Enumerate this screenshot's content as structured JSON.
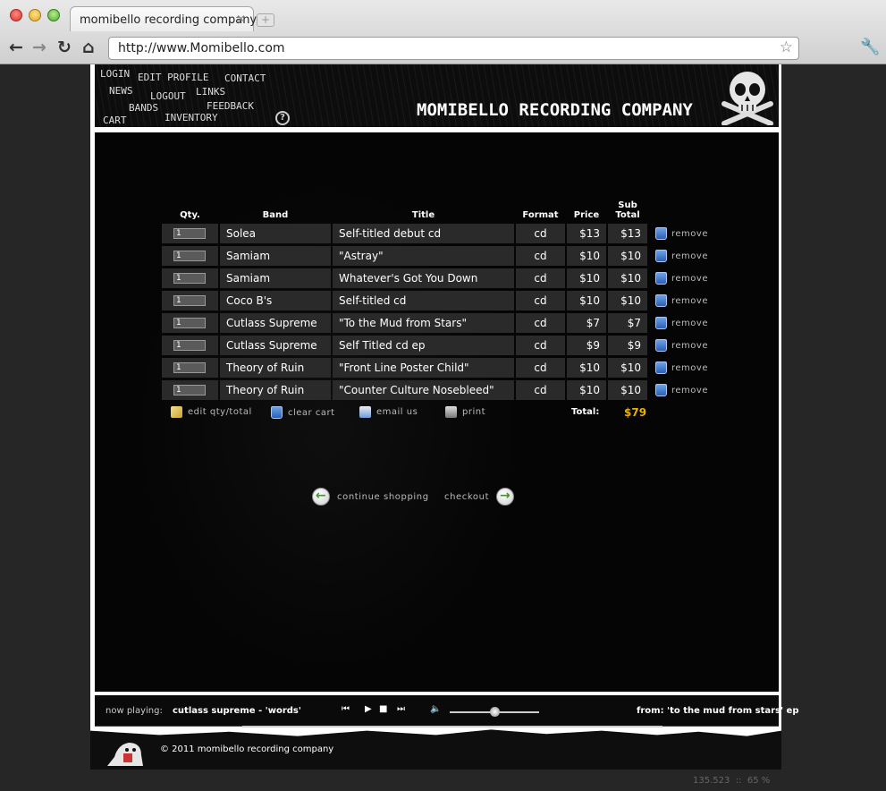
{
  "browser": {
    "tab_title": "momibello recording company",
    "url": "http://www.Momibello.com",
    "tab_close": "×",
    "new_tab": "+"
  },
  "nav": {
    "login": "LOGIN",
    "edit_profile": "EDIT PROFILE",
    "contact": "CONTACT",
    "news": "NEWS",
    "logout": "LOGOUT",
    "links": "LINKS",
    "bands": "BANDS",
    "feedback": "FEEDBACK",
    "cart": "CART",
    "inventory": "INVENTORY",
    "help": "?"
  },
  "brand": "MOMIBELLO RECORDING COMPANY",
  "cart": {
    "headers": {
      "qty": "Qty.",
      "band": "Band",
      "title": "Title",
      "format": "Format",
      "price": "Price",
      "subtotal_1": "Sub",
      "subtotal_2": "Total"
    },
    "remove_label": "remove",
    "rows": [
      {
        "qty": "1",
        "band": "Solea",
        "title": "Self-titled debut cd",
        "format": "cd",
        "price": "$13",
        "subtotal": "$13"
      },
      {
        "qty": "1",
        "band": "Samiam",
        "title": "\"Astray\"",
        "format": "cd",
        "price": "$10",
        "subtotal": "$10"
      },
      {
        "qty": "1",
        "band": "Samiam",
        "title": "Whatever's Got You Down",
        "format": "cd",
        "price": "$10",
        "subtotal": "$10"
      },
      {
        "qty": "1",
        "band": "Coco B's",
        "title": "Self-titled cd",
        "format": "cd",
        "price": "$10",
        "subtotal": "$10"
      },
      {
        "qty": "1",
        "band": "Cutlass Supreme",
        "title": "\"To the Mud from Stars\"",
        "format": "cd",
        "price": "$7",
        "subtotal": "$7"
      },
      {
        "qty": "1",
        "band": "Cutlass Supreme",
        "title": "Self Titled cd ep",
        "format": "cd",
        "price": "$9",
        "subtotal": "$9"
      },
      {
        "qty": "1",
        "band": "Theory of Ruin",
        "title": "\"Front Line Poster Child\"",
        "format": "cd",
        "price": "$10",
        "subtotal": "$10"
      },
      {
        "qty": "1",
        "band": "Theory of Ruin",
        "title": "\"Counter Culture Nosebleed\"",
        "format": "cd",
        "price": "$10",
        "subtotal": "$10"
      }
    ],
    "actions": {
      "edit": "edit qty/total",
      "clear": "clear cart",
      "email": "email us",
      "print": "print"
    },
    "total_label": "Total:",
    "total_value": "$79",
    "continue_shopping": "continue shopping",
    "checkout": "checkout"
  },
  "player": {
    "now_playing_label": "now playing:",
    "track": "cutlass supreme - 'words'",
    "from": "from: 'to the mud from stars' ep",
    "volume_level": 0.5
  },
  "footer": {
    "copyright": "©  2011 momibello recording company"
  },
  "status": {
    "count": "135.523",
    "sep": "::",
    "zoom": "65 %"
  },
  "colors": {
    "accent_total": "#e8b100",
    "row_bg": "#2a2a2a"
  }
}
